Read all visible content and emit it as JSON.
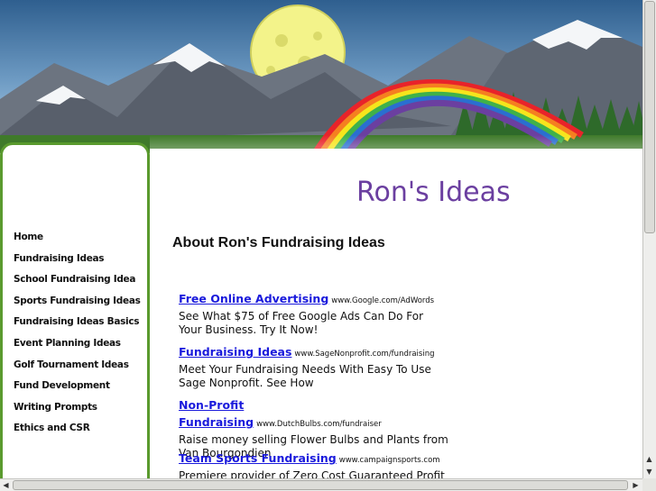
{
  "site": {
    "title": "Ron's Ideas"
  },
  "nav": {
    "items": [
      "Home",
      "Fundraising Ideas",
      "School Fundraising Idea",
      "Sports Fundraising Ideas",
      "Fundraising Ideas Basics",
      "Event Planning Ideas",
      "Golf Tournament Ideas",
      "Fund Development",
      "Writing Prompts",
      "Ethics and CSR"
    ]
  },
  "main": {
    "heading": "About Ron's Fundraising Ideas"
  },
  "ads": [
    {
      "title": "Free Online Advertising",
      "url": "www.Google.com/AdWords",
      "desc": "See What $75 of Free Google Ads Can Do For Your Business. Try It Now!"
    },
    {
      "title": "Fundraising Ideas",
      "url": "www.SageNonprofit.com/fundraising",
      "desc": "Meet Your Fundraising Needs With Easy To Use Sage Nonprofit. See How"
    },
    {
      "title": "Non-Profit Fundraising",
      "url": "www.DutchBulbs.com/fundraiser",
      "desc": "Raise money selling Flower Bulbs and Plants from Van Bourgondien"
    },
    {
      "title": "Team Sports Fundraising",
      "url": "www.campaignsports.com",
      "desc": "Premiere provider of Zero Cost Guaranteed Profit"
    }
  ],
  "colors": {
    "sky_top": "#2f5f8f",
    "sky_bottom": "#9fc3e0",
    "sidebar_border": "#5a9a2e",
    "title": "#6b3fa0",
    "ad_link": "#1a1adc"
  }
}
